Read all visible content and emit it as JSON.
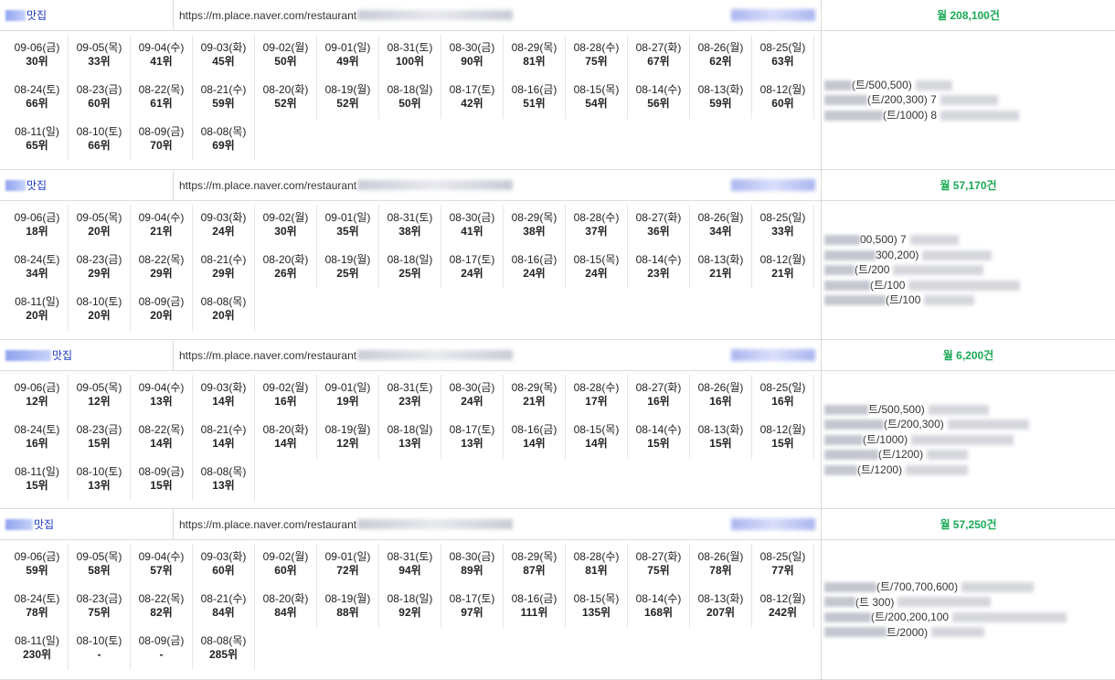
{
  "rows": [
    {
      "name_suffix": "맛집",
      "url_prefix": "https://m.place.naver.com/restaurant",
      "monthly": "월 208,100건",
      "dates": [
        {
          "d": "09-06(금)",
          "r": "30위"
        },
        {
          "d": "09-05(목)",
          "r": "33위"
        },
        {
          "d": "09-04(수)",
          "r": "41위"
        },
        {
          "d": "09-03(화)",
          "r": "45위"
        },
        {
          "d": "09-02(월)",
          "r": "50위"
        },
        {
          "d": "09-01(일)",
          "r": "49위"
        },
        {
          "d": "08-31(토)",
          "r": "100위"
        },
        {
          "d": "08-30(금)",
          "r": "90위"
        },
        {
          "d": "08-29(목)",
          "r": "81위"
        },
        {
          "d": "08-28(수)",
          "r": "75위"
        },
        {
          "d": "08-27(화)",
          "r": "67위"
        },
        {
          "d": "08-26(월)",
          "r": "62위"
        },
        {
          "d": "08-25(일)",
          "r": "63위"
        },
        {
          "d": "08-24(토)",
          "r": "66위"
        },
        {
          "d": "08-23(금)",
          "r": "60위"
        },
        {
          "d": "08-22(목)",
          "r": "61위"
        },
        {
          "d": "08-21(수)",
          "r": "59위"
        },
        {
          "d": "08-20(화)",
          "r": "52위"
        },
        {
          "d": "08-19(월)",
          "r": "52위"
        },
        {
          "d": "08-18(일)",
          "r": "50위"
        },
        {
          "d": "08-17(토)",
          "r": "42위"
        },
        {
          "d": "08-16(금)",
          "r": "51위"
        },
        {
          "d": "08-15(목)",
          "r": "54위"
        },
        {
          "d": "08-14(수)",
          "r": "56위"
        },
        {
          "d": "08-13(화)",
          "r": "59위"
        },
        {
          "d": "08-12(월)",
          "r": "60위"
        },
        {
          "d": "08-11(일)",
          "r": "65위"
        },
        {
          "d": "08-10(토)",
          "r": "66위"
        },
        {
          "d": "08-09(금)",
          "r": "70위"
        },
        {
          "d": "08-08(목)",
          "r": "69위"
        }
      ],
      "notes": [
        "(트/500,500)",
        "(트/200,300) 7",
        "(트/1000) 8"
      ]
    },
    {
      "name_suffix": "맛집",
      "url_prefix": "https://m.place.naver.com/restaurant",
      "monthly": "월 57,170건",
      "dates": [
        {
          "d": "09-06(금)",
          "r": "18위"
        },
        {
          "d": "09-05(목)",
          "r": "20위"
        },
        {
          "d": "09-04(수)",
          "r": "21위"
        },
        {
          "d": "09-03(화)",
          "r": "24위"
        },
        {
          "d": "09-02(월)",
          "r": "30위"
        },
        {
          "d": "09-01(일)",
          "r": "35위"
        },
        {
          "d": "08-31(토)",
          "r": "38위"
        },
        {
          "d": "08-30(금)",
          "r": "41위"
        },
        {
          "d": "08-29(목)",
          "r": "38위"
        },
        {
          "d": "08-28(수)",
          "r": "37위"
        },
        {
          "d": "08-27(화)",
          "r": "36위"
        },
        {
          "d": "08-26(월)",
          "r": "34위"
        },
        {
          "d": "08-25(일)",
          "r": "33위"
        },
        {
          "d": "08-24(토)",
          "r": "34위"
        },
        {
          "d": "08-23(금)",
          "r": "29위"
        },
        {
          "d": "08-22(목)",
          "r": "29위"
        },
        {
          "d": "08-21(수)",
          "r": "29위"
        },
        {
          "d": "08-20(화)",
          "r": "26위"
        },
        {
          "d": "08-19(월)",
          "r": "25위"
        },
        {
          "d": "08-18(일)",
          "r": "25위"
        },
        {
          "d": "08-17(토)",
          "r": "24위"
        },
        {
          "d": "08-16(금)",
          "r": "24위"
        },
        {
          "d": "08-15(목)",
          "r": "24위"
        },
        {
          "d": "08-14(수)",
          "r": "23위"
        },
        {
          "d": "08-13(화)",
          "r": "21위"
        },
        {
          "d": "08-12(월)",
          "r": "21위"
        },
        {
          "d": "08-11(일)",
          "r": "20위"
        },
        {
          "d": "08-10(토)",
          "r": "20위"
        },
        {
          "d": "08-09(금)",
          "r": "20위"
        },
        {
          "d": "08-08(목)",
          "r": "20위"
        }
      ],
      "notes": [
        "00,500) 7",
        "300,200)",
        "(트/200",
        "(트/100",
        "(트/100"
      ]
    },
    {
      "name_suffix": "맛집",
      "url_prefix": "https://m.place.naver.com/restaurant",
      "monthly": "월 6,200건",
      "dates": [
        {
          "d": "09-06(금)",
          "r": "12위"
        },
        {
          "d": "09-05(목)",
          "r": "12위"
        },
        {
          "d": "09-04(수)",
          "r": "13위"
        },
        {
          "d": "09-03(화)",
          "r": "14위"
        },
        {
          "d": "09-02(월)",
          "r": "16위"
        },
        {
          "d": "09-01(일)",
          "r": "19위"
        },
        {
          "d": "08-31(토)",
          "r": "23위"
        },
        {
          "d": "08-30(금)",
          "r": "24위"
        },
        {
          "d": "08-29(목)",
          "r": "21위"
        },
        {
          "d": "08-28(수)",
          "r": "17위"
        },
        {
          "d": "08-27(화)",
          "r": "16위"
        },
        {
          "d": "08-26(월)",
          "r": "16위"
        },
        {
          "d": "08-25(일)",
          "r": "16위"
        },
        {
          "d": "08-24(토)",
          "r": "16위"
        },
        {
          "d": "08-23(금)",
          "r": "15위"
        },
        {
          "d": "08-22(목)",
          "r": "14위"
        },
        {
          "d": "08-21(수)",
          "r": "14위"
        },
        {
          "d": "08-20(화)",
          "r": "14위"
        },
        {
          "d": "08-19(월)",
          "r": "12위"
        },
        {
          "d": "08-18(일)",
          "r": "13위"
        },
        {
          "d": "08-17(토)",
          "r": "13위"
        },
        {
          "d": "08-16(금)",
          "r": "14위"
        },
        {
          "d": "08-15(목)",
          "r": "14위"
        },
        {
          "d": "08-14(수)",
          "r": "15위"
        },
        {
          "d": "08-13(화)",
          "r": "15위"
        },
        {
          "d": "08-12(월)",
          "r": "15위"
        },
        {
          "d": "08-11(일)",
          "r": "15위"
        },
        {
          "d": "08-10(토)",
          "r": "13위"
        },
        {
          "d": "08-09(금)",
          "r": "15위"
        },
        {
          "d": "08-08(목)",
          "r": "13위"
        }
      ],
      "notes": [
        "트/500,500)",
        "(트/200,300)",
        "(트/1000)",
        "(트/1200)",
        "(트/1200)"
      ]
    },
    {
      "name_suffix": "맛집",
      "url_prefix": "https://m.place.naver.com/restaurant",
      "monthly": "월 57,250건",
      "dates": [
        {
          "d": "09-06(금)",
          "r": "59위"
        },
        {
          "d": "09-05(목)",
          "r": "58위"
        },
        {
          "d": "09-04(수)",
          "r": "57위"
        },
        {
          "d": "09-03(화)",
          "r": "60위"
        },
        {
          "d": "09-02(월)",
          "r": "60위"
        },
        {
          "d": "09-01(일)",
          "r": "72위"
        },
        {
          "d": "08-31(토)",
          "r": "94위"
        },
        {
          "d": "08-30(금)",
          "r": "89위"
        },
        {
          "d": "08-29(목)",
          "r": "87위"
        },
        {
          "d": "08-28(수)",
          "r": "81위"
        },
        {
          "d": "08-27(화)",
          "r": "75위"
        },
        {
          "d": "08-26(월)",
          "r": "78위"
        },
        {
          "d": "08-25(일)",
          "r": "77위"
        },
        {
          "d": "08-24(토)",
          "r": "78위"
        },
        {
          "d": "08-23(금)",
          "r": "75위"
        },
        {
          "d": "08-22(목)",
          "r": "82위"
        },
        {
          "d": "08-21(수)",
          "r": "84위"
        },
        {
          "d": "08-20(화)",
          "r": "84위"
        },
        {
          "d": "08-19(월)",
          "r": "88위"
        },
        {
          "d": "08-18(일)",
          "r": "92위"
        },
        {
          "d": "08-17(토)",
          "r": "97위"
        },
        {
          "d": "08-16(금)",
          "r": "111위"
        },
        {
          "d": "08-15(목)",
          "r": "135위"
        },
        {
          "d": "08-14(수)",
          "r": "168위"
        },
        {
          "d": "08-13(화)",
          "r": "207위"
        },
        {
          "d": "08-12(월)",
          "r": "242위"
        },
        {
          "d": "08-11(일)",
          "r": "230위"
        },
        {
          "d": "08-10(토)",
          "r": "-"
        },
        {
          "d": "08-09(금)",
          "r": "-"
        },
        {
          "d": "08-08(목)",
          "r": "285위"
        }
      ],
      "notes": [
        "(트/700,700,600)",
        "(트 300)",
        "(트/200,200,100",
        "트/2000)"
      ]
    }
  ]
}
